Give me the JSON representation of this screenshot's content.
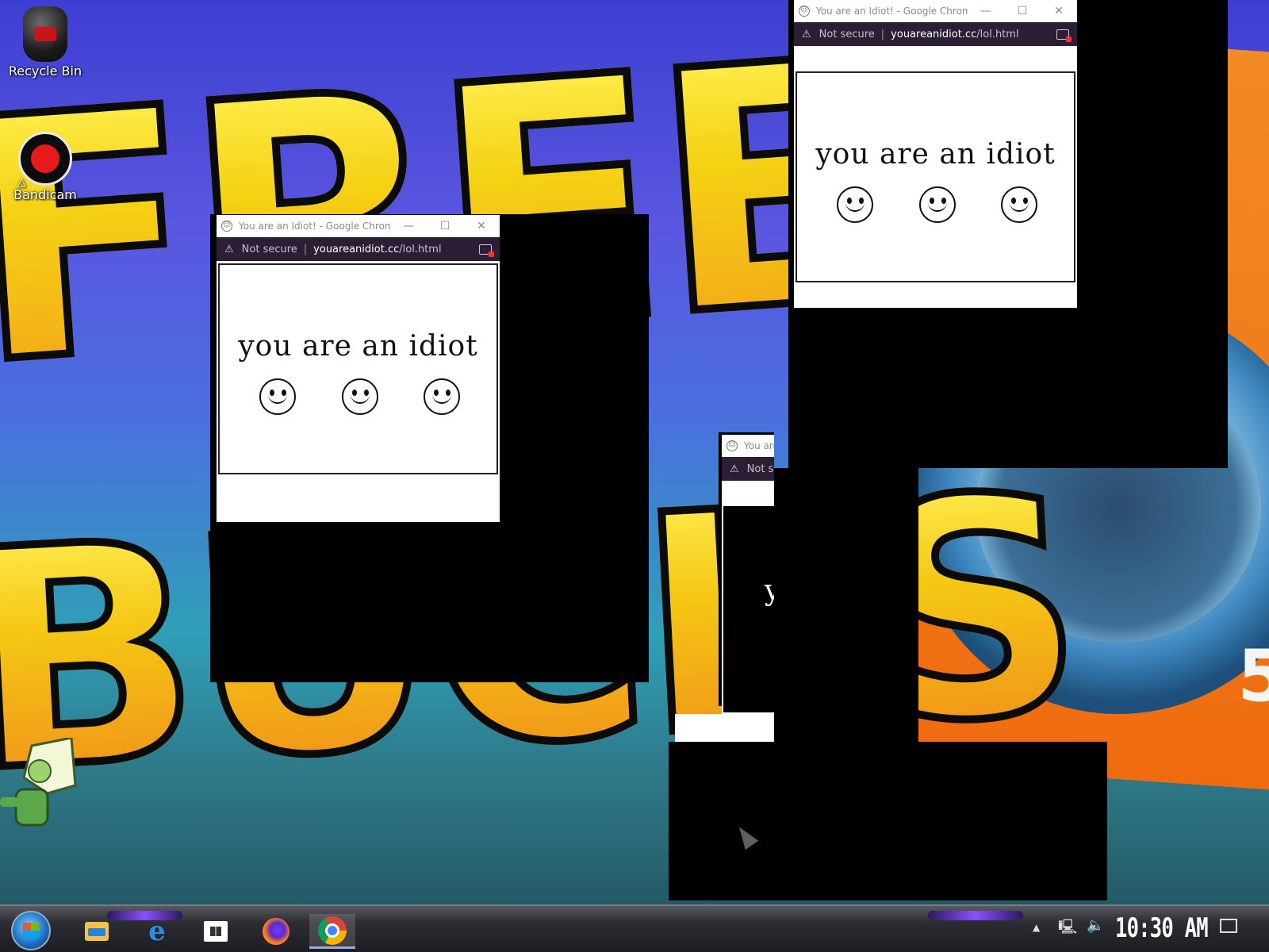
{
  "desktop": {
    "icons": [
      {
        "label": "Recycle Bin"
      },
      {
        "label": "Bandicam"
      }
    ],
    "wallpaper": {
      "line1": "FREE",
      "line2": "BUCKS",
      "corner": "5"
    }
  },
  "popups": [
    {
      "title": "You are an Idiot! - Google Chrome",
      "security": "Not secure",
      "url_host": "youareanidiot.cc",
      "url_path": "/lol.html",
      "message": "you are an idiot"
    },
    {
      "title": "You are an Idiot! - Google Chrome",
      "security": "Not secure",
      "url_host": "youareanidiot.cc",
      "url_path": "/lol.html",
      "message": "you are an idiot"
    },
    {
      "title": "You are",
      "security": "Not s",
      "message": "y"
    }
  ],
  "window_controls": {
    "minimize": "—",
    "maximize": "☐",
    "close": "✕"
  },
  "taskbar": {
    "apps": [
      "file-explorer",
      "edge",
      "store",
      "firefox",
      "chrome"
    ],
    "clock": "10:30 AM",
    "tray_up": "▲"
  },
  "colors": {
    "address_bar": "#2c1e34",
    "accent": "#8a4fff"
  }
}
